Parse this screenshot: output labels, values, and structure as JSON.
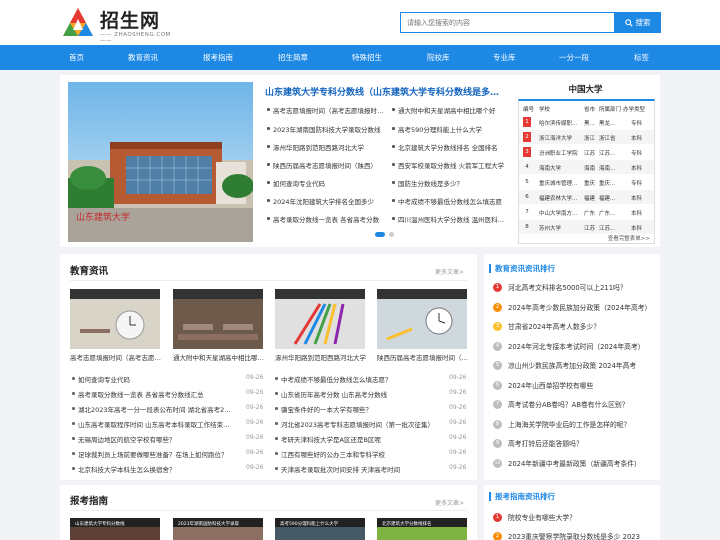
{
  "header": {
    "logo_text": "招生网",
    "logo_sub": "—— ZHAOSHENG.COM ——",
    "search_placeholder": "请输入您搜索的内容",
    "search_button": "搜索"
  },
  "nav": [
    "首页",
    "教育资讯",
    "报考指南",
    "招生简章",
    "特殊招生",
    "院校库",
    "专业库",
    "一分一段",
    "标签"
  ],
  "hero": {
    "title": "山东建筑大学专科分数线（山东建筑大学专科分数线是多少）",
    "image_caption": "山东建筑大学",
    "left_list": [
      "高考志愿填报时间（高考志愿填报时间）",
      "2023年湖南国防科技大学录取分数线",
      "涿州华阳路到范阳西路河北大学",
      "陕西历届高考志愿填报时间（陕西）",
      "如何查询专业代码",
      "2024年沈阳建筑大学排名全国多少",
      "高考录取分数线一览表 各省高考分数"
    ],
    "right_list": [
      "通大附中和天星湖高中相比哪个好",
      "高考590分理科能上什么大学",
      "北京建筑大学分数线排名 全国排名",
      "西安军校录取分数线 火箭军工程大学",
      "国防生分数线是多少？",
      "中考成绩不够最低分数线怎么填志愿",
      "四川温州医科大学分数线 温州医科大学"
    ]
  },
  "china_univ": {
    "title": "中国大学",
    "headers": [
      "编号",
      "学校",
      "省市",
      "所属部门",
      "办学类型"
    ],
    "rows": [
      [
        "1",
        "哈尔滨传媒职...",
        "黑...",
        "黑龙...",
        "专科"
      ],
      [
        "2",
        "浙江海洋大学",
        "浙江",
        "浙江省",
        "本科"
      ],
      [
        "3",
        "汾洲职业工学院",
        "江苏",
        "江苏...",
        "专科"
      ],
      [
        "4",
        "海南大学",
        "海南",
        "海南...",
        "本科"
      ],
      [
        "5",
        "重庆城市管理...",
        "重庆",
        "重庆...",
        "专科"
      ],
      [
        "6",
        "福建农林大学...",
        "福建",
        "福建...",
        "本科"
      ],
      [
        "7",
        "中山大学南方...",
        "广东",
        "广东...",
        "本科"
      ],
      [
        "8",
        "苏州大学",
        "江苏",
        "江苏...",
        "本科"
      ]
    ],
    "more": "查看完整表单>>"
  },
  "edu": {
    "title": "教育资讯",
    "more": "更多文章>",
    "thumbs": [
      "高考志愿填报时间（高考志愿填报时间）",
      "通大附中和天星湖高中相比哪个好",
      "涿州华阳路到范阳西路河北大学",
      "陕西历届高考志愿填报时间（陕西）"
    ],
    "list": [
      {
        "t": "如何查询专业代码",
        "d": "09-26"
      },
      {
        "t": "中考成绩不够最低分数线怎么填志愿？",
        "d": "09-26"
      },
      {
        "t": "高考录取分数线一览表 各省高考分数线汇总",
        "d": "09-26"
      },
      {
        "t": "山东省历年高考分数 山东高考分数线",
        "d": "09-26"
      },
      {
        "t": "湖北2023年高考一分一段表公布时间 湖北省高考2023",
        "d": "09-26"
      },
      {
        "t": "骥宝条件好的一本大学有哪些？",
        "d": "09-26"
      },
      {
        "t": "山东高考录取程序时间 山东高考本科录取工作结束时间",
        "d": "09-26"
      },
      {
        "t": "河北省2023高考专科志愿填报时间（第一批次征集）",
        "d": "09-26"
      },
      {
        "t": "无锡周边地区的航空学校有哪些？",
        "d": "09-26"
      },
      {
        "t": "考研天津科技大学是A区还是B区呢",
        "d": "09-26"
      },
      {
        "t": "足球裁判员上场前要做哪些准备？在场上如何跑位？",
        "d": "09-26"
      },
      {
        "t": "江西有哪些好的公办三本和专科学校",
        "d": "09-26"
      },
      {
        "t": "北京科技大学本科生怎么换宿舍？",
        "d": "09-26"
      },
      {
        "t": "天津高考录取批次时间安排 天津高考时间",
        "d": "09-26"
      }
    ]
  },
  "edu_rank": {
    "title": "教育资讯资讯排行",
    "items": [
      "河北高考文科排名5000可以上211吗？",
      "2024年高考少数民族加分政策（2024年高考）",
      "甘肃省2024年高考人数多少？",
      "2024年河北专接本考试时间（2024年高考）",
      "凉山州少数民族高考加分政策 2024年高考",
      "2024年山西单招学校有哪些",
      "高考试卷分AB卷吗？AB卷有什么区别？",
      "上海海关学院毕业后的工作是怎样的呢？",
      "高考打铃后还能答题吗？",
      "2024年新疆中考最新政策（新疆高考条件）"
    ],
    "colors": [
      "#e53935",
      "#fb8c00",
      "#fbc02d",
      "#bdbdbd",
      "#bdbdbd",
      "#bdbdbd",
      "#bdbdbd",
      "#bdbdbd",
      "#bdbdbd",
      "#bdbdbd"
    ]
  },
  "guide": {
    "title": "报考指南",
    "more": "更多文章>",
    "thumbs": [
      "山东建筑大学专科分数线",
      "2023年湖南国防科技大学录取",
      "高考590分理科能上什么大学",
      "北京建筑大学分数线排名"
    ]
  },
  "guide_rank": {
    "title": "报考指南资讯排行",
    "items": [
      "院校专业有哪些大学？",
      "2023重庆警察学院录取分数线是多少 2023"
    ],
    "colors": [
      "#e53935",
      "#fb8c00"
    ]
  }
}
